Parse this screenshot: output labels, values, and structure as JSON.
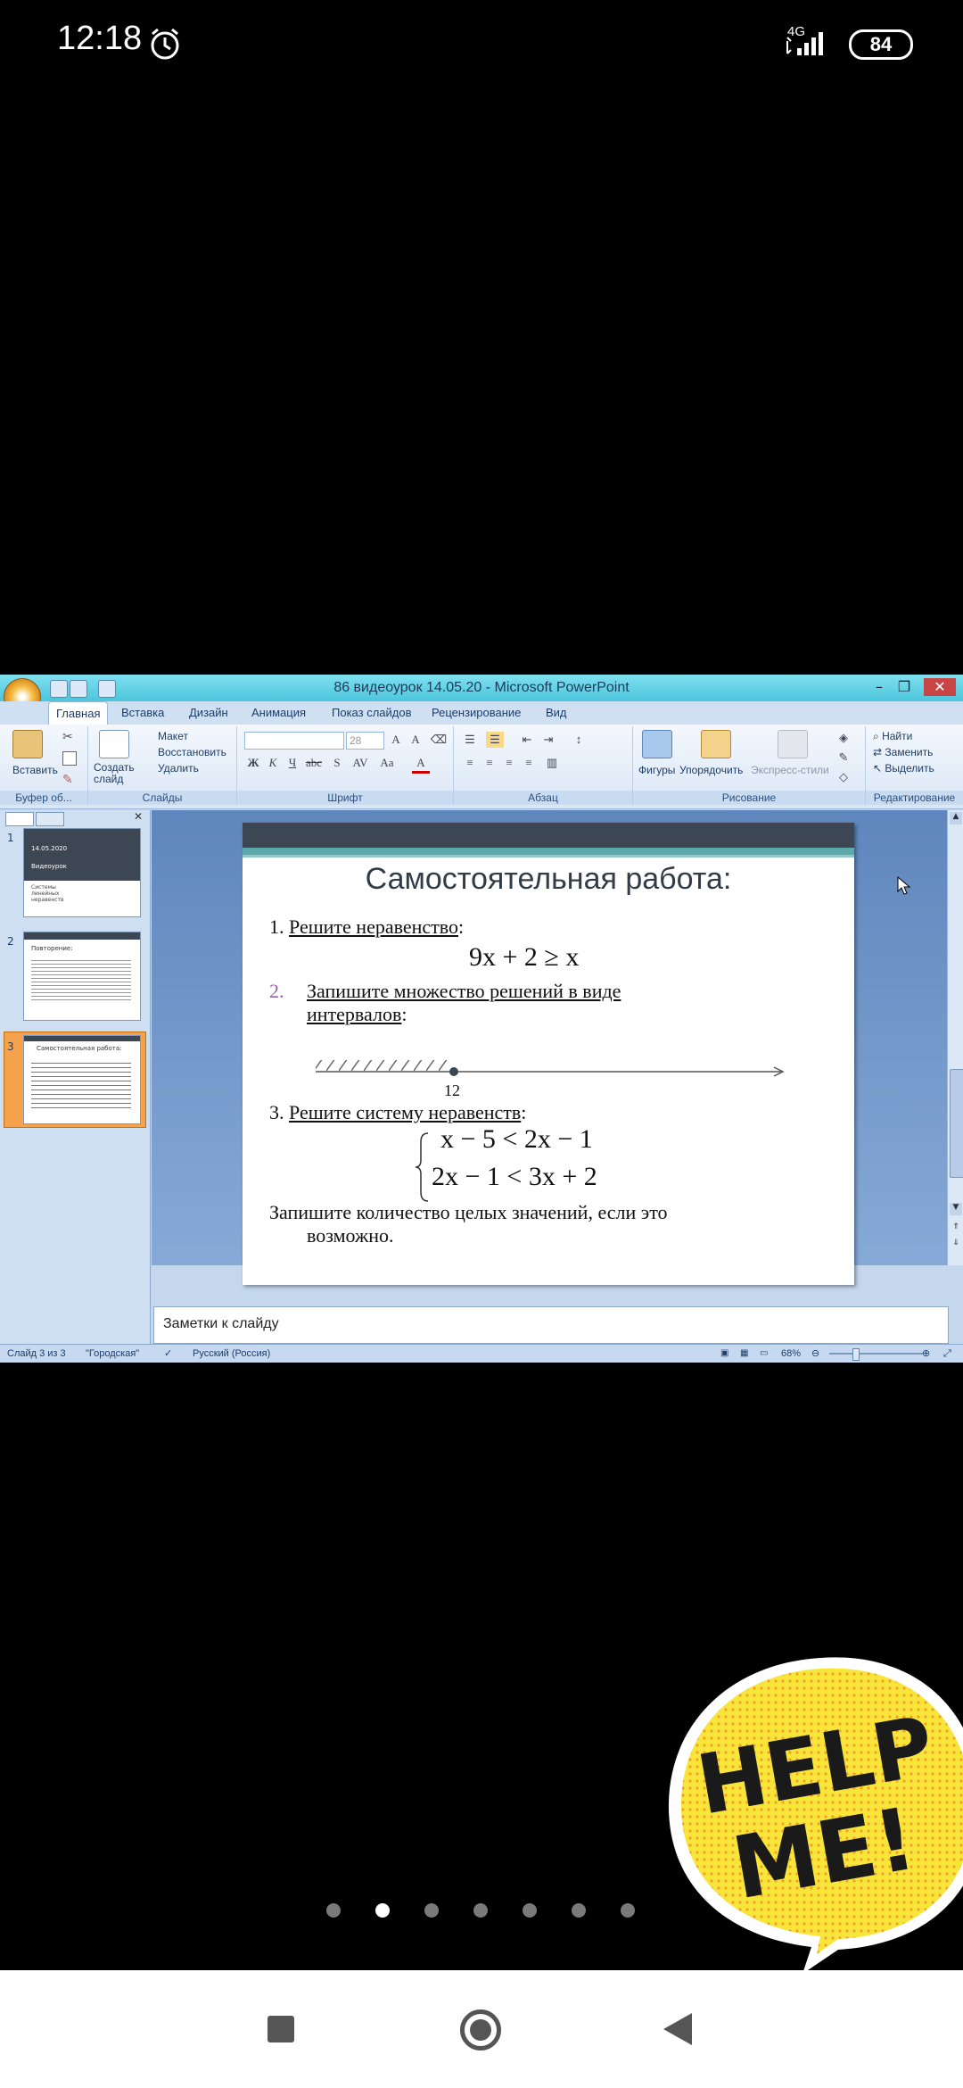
{
  "status_bar": {
    "time": "12:18",
    "network": "4G",
    "battery": "84"
  },
  "window": {
    "title": "86 видеоурок 14.05.20 - Microsoft PowerPoint"
  },
  "tabs": [
    "Главная",
    "Вставка",
    "Дизайн",
    "Анимация",
    "Показ слайдов",
    "Рецензирование",
    "Вид"
  ],
  "ribbon": {
    "paste": "Вставить",
    "create_slide": "Создать слайд",
    "layout": "Макет",
    "reset": "Восстановить",
    "delete": "Удалить",
    "font_size": "28",
    "shapes": "Фигуры",
    "arrange": "Упорядочить",
    "quick_styles": "Экспресс-стили",
    "find": "Найти",
    "replace": "Заменить",
    "select": "Выделить",
    "groups": [
      "Буфер об...",
      "Слайды",
      "Шрифт",
      "Абзац",
      "Рисование",
      "Редактирование"
    ]
  },
  "thumbnails": [
    {
      "num": "1",
      "lines": [
        "14.05.2020",
        "Видеоурок",
        "Системы линейных неравенств"
      ]
    },
    {
      "num": "2",
      "lines": [
        "Повторение:"
      ]
    },
    {
      "num": "3",
      "lines": [
        "Самостоятельная работа:"
      ]
    }
  ],
  "slide": {
    "title": "Самостоятельная работа:",
    "task1_num": "1.",
    "task1": "Решите неравенство",
    "colon": ":",
    "eq1": "9x + 2 ≥ x",
    "task2_num": "2.",
    "task2_line1": "Запишите множество решений в виде",
    "task2_line2": "интервалов",
    "tick": "12",
    "task3_num": "3.",
    "task3": "Решите систему неравенств",
    "sys1": "x − 5 < 2x − 1",
    "sys2": "2x − 1 < 3x + 2",
    "final_line1": "Запишите количество целых значений, если это",
    "final_line2": "возможно."
  },
  "notes_placeholder": "Заметки к слайду",
  "statusbar": {
    "slide": "Слайд 3 из 3",
    "theme": "\"Городская\"",
    "lang": "Русский (Россия)",
    "zoom": "68%"
  },
  "sticker": {
    "line1": "HELP",
    "line2": "ME!"
  },
  "pagination": {
    "count": 7,
    "active_index": 1
  }
}
